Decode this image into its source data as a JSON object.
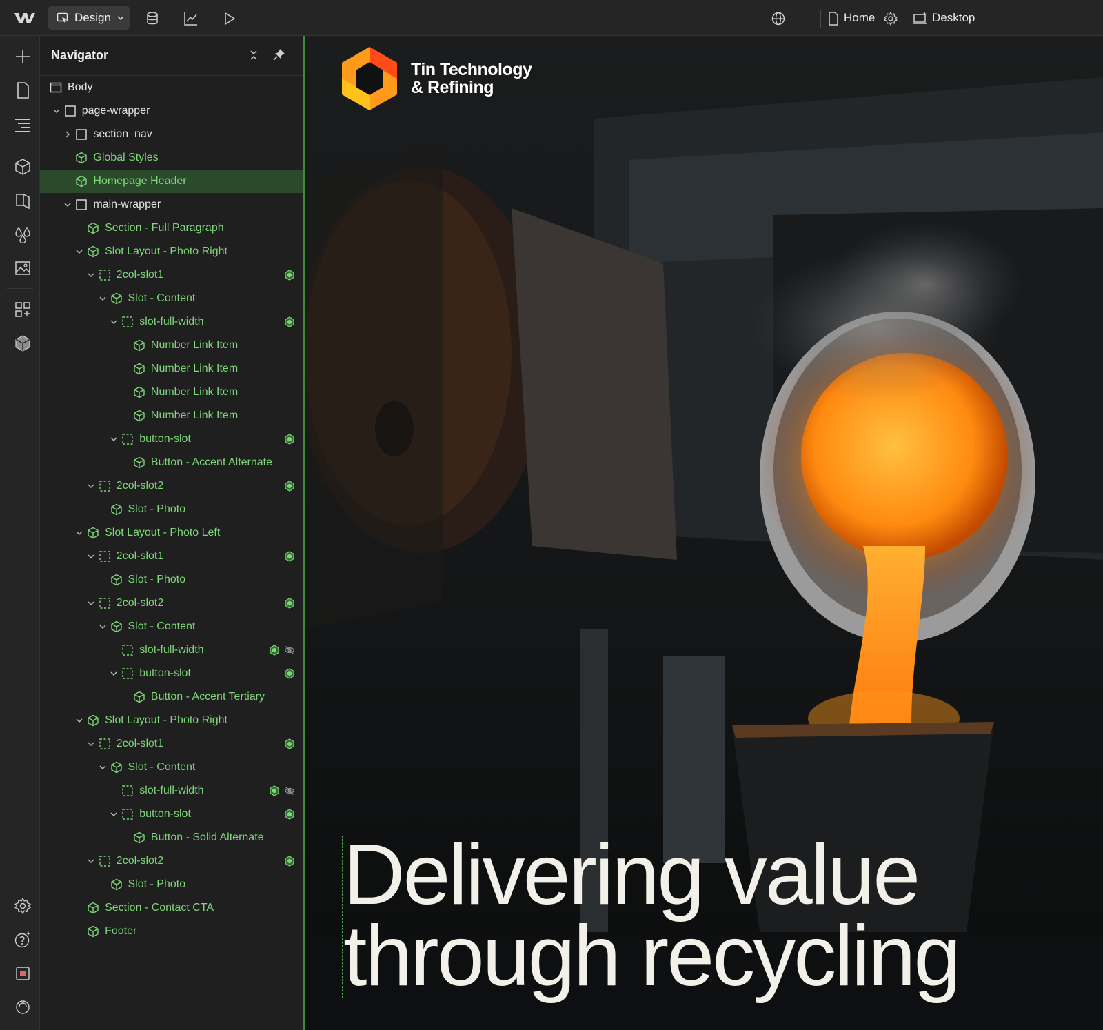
{
  "toolbar": {
    "mode_label": "Design",
    "page_label": "Home",
    "breakpoint_label": "Desktop",
    "icons": [
      "webflow-logo-icon",
      "database-icon",
      "analytics-icon",
      "play-icon",
      "globe-icon",
      "page-icon",
      "gear-icon",
      "desktop-icon"
    ]
  },
  "navigator": {
    "title": "Navigator",
    "items": [
      {
        "label": "Body",
        "depth": 0,
        "type": "box",
        "expand": "none"
      },
      {
        "label": "page-wrapper",
        "depth": 1,
        "type": "box",
        "expand": "open"
      },
      {
        "label": "section_nav",
        "depth": 2,
        "type": "box",
        "expand": "closed"
      },
      {
        "label": "Global Styles",
        "depth": 2,
        "type": "component",
        "expand": "none"
      },
      {
        "label": "Homepage Header",
        "depth": 2,
        "type": "component",
        "expand": "none",
        "selected": true
      },
      {
        "label": "main-wrapper",
        "depth": 2,
        "type": "box",
        "expand": "open"
      },
      {
        "label": "Section - Full Paragraph",
        "depth": 3,
        "type": "component",
        "expand": "none"
      },
      {
        "label": "Slot Layout - Photo Right",
        "depth": 3,
        "type": "component",
        "expand": "open"
      },
      {
        "label": "2col-slot1",
        "depth": 4,
        "type": "slot",
        "expand": "open",
        "badge": true
      },
      {
        "label": "Slot - Content",
        "depth": 5,
        "type": "component",
        "expand": "open"
      },
      {
        "label": "slot-full-width",
        "depth": 6,
        "type": "slot",
        "expand": "open",
        "badge": true
      },
      {
        "label": "Number Link Item",
        "depth": 7,
        "type": "component",
        "expand": "none"
      },
      {
        "label": "Number Link Item",
        "depth": 7,
        "type": "component",
        "expand": "none"
      },
      {
        "label": "Number Link Item",
        "depth": 7,
        "type": "component",
        "expand": "none"
      },
      {
        "label": "Number Link Item",
        "depth": 7,
        "type": "component",
        "expand": "none"
      },
      {
        "label": "button-slot",
        "depth": 6,
        "type": "slot",
        "expand": "open",
        "badge": true
      },
      {
        "label": "Button - Accent Alternate",
        "depth": 7,
        "type": "component",
        "expand": "none"
      },
      {
        "label": "2col-slot2",
        "depth": 4,
        "type": "slot",
        "expand": "open",
        "badge": true
      },
      {
        "label": "Slot - Photo",
        "depth": 5,
        "type": "component",
        "expand": "none"
      },
      {
        "label": "Slot Layout - Photo Left",
        "depth": 3,
        "type": "component",
        "expand": "open"
      },
      {
        "label": "2col-slot1",
        "depth": 4,
        "type": "slot",
        "expand": "open",
        "badge": true
      },
      {
        "label": "Slot - Photo",
        "depth": 5,
        "type": "component",
        "expand": "none"
      },
      {
        "label": "2col-slot2",
        "depth": 4,
        "type": "slot",
        "expand": "open",
        "badge": true
      },
      {
        "label": "Slot - Content",
        "depth": 5,
        "type": "component",
        "expand": "open"
      },
      {
        "label": "slot-full-width",
        "depth": 6,
        "type": "slot",
        "expand": "none",
        "badge": true,
        "hidden": true
      },
      {
        "label": "button-slot",
        "depth": 6,
        "type": "slot",
        "expand": "open",
        "badge": true
      },
      {
        "label": "Button - Accent Tertiary",
        "depth": 7,
        "type": "component",
        "expand": "none"
      },
      {
        "label": "Slot Layout - Photo Right",
        "depth": 3,
        "type": "component",
        "expand": "open"
      },
      {
        "label": "2col-slot1",
        "depth": 4,
        "type": "slot",
        "expand": "open",
        "badge": true
      },
      {
        "label": "Slot - Content",
        "depth": 5,
        "type": "component",
        "expand": "open"
      },
      {
        "label": "slot-full-width",
        "depth": 6,
        "type": "slot",
        "expand": "none",
        "badge": true,
        "hidden": true
      },
      {
        "label": "button-slot",
        "depth": 6,
        "type": "slot",
        "expand": "open",
        "badge": true
      },
      {
        "label": "Button - Solid Alternate",
        "depth": 7,
        "type": "component",
        "expand": "none"
      },
      {
        "label": "2col-slot2",
        "depth": 4,
        "type": "slot",
        "expand": "open",
        "badge": true
      },
      {
        "label": "Slot - Photo",
        "depth": 5,
        "type": "component",
        "expand": "none"
      },
      {
        "label": "Section - Contact CTA",
        "depth": 3,
        "type": "component",
        "expand": "none"
      },
      {
        "label": "Footer",
        "depth": 3,
        "type": "component",
        "expand": "none"
      }
    ]
  },
  "canvas": {
    "brand_line1": "Tin Technology",
    "brand_line2": "& Refining",
    "headline_line1": "Delivering value",
    "headline_line2": "through recycling"
  },
  "colors": {
    "accent_green": "#7fd67a",
    "selection": "#2b4a2b",
    "canvas_border": "#3c8c3c",
    "molten": "#ff9a1a"
  }
}
